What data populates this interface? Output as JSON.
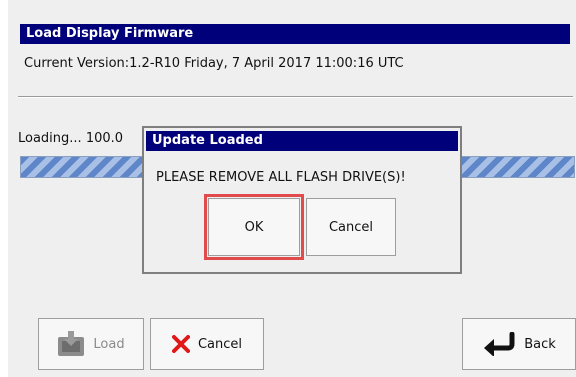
{
  "window": {
    "title": "Load Display Firmware",
    "version_line": "Current Version:1.2-R10   Friday, 7 April 2017 11:00:16 UTC"
  },
  "progress": {
    "label": "Loading... 100.0",
    "fraction": 1.0
  },
  "dialog": {
    "title": "Update Loaded",
    "message": "PLEASE REMOVE ALL FLASH DRIVE(S)!",
    "ok_label": "OK",
    "cancel_label": "Cancel"
  },
  "toolbar": {
    "load_label": "Load",
    "cancel_label": "Cancel",
    "back_label": "Back",
    "load_icon": "download-icon",
    "cancel_icon": "red-x-icon",
    "back_icon": "back-arrow-icon"
  },
  "colors": {
    "titlebar": "#00007a",
    "highlight": "#e14b4b",
    "progress_fill": "#5f86c8"
  }
}
